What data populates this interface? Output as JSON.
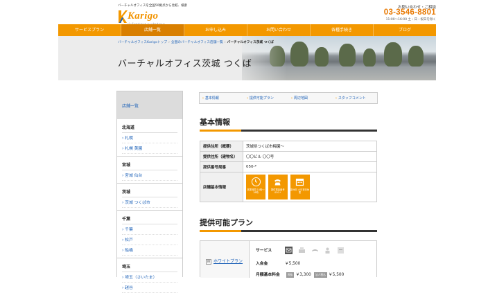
{
  "header": {
    "tagline": "バーチャルオフィスを全国50拠点から比較、検索",
    "logo_text": "Karigo",
    "logo_sub": "バーチャルオフィス・レンタルオフィス",
    "contact_label": "お問い合わせ・ご相談",
    "phone": "03-3546-8801",
    "hours": "11:00〜16:00 土・日・祝日を除く"
  },
  "nav": {
    "items": [
      "サービスプラン",
      "店舗一覧",
      "お申し込み",
      "お問い合わせ",
      "各種手続き",
      "ブログ"
    ],
    "active_index": 1
  },
  "hero": {
    "breadcrumb": [
      "バーチャルオフィスKarigoトップ",
      "全国のバーチャルオフィス店舗一覧"
    ],
    "breadcrumb_current": "バーチャルオフィス茨城 つくば",
    "title": "バーチャルオフィス茨城 つくば"
  },
  "sidebar": {
    "head": "店舗一覧",
    "regions": [
      {
        "name": "北海道",
        "links": [
          "札幌",
          "札幌 美園"
        ]
      },
      {
        "name": "宮城",
        "links": [
          "宮城 仙台"
        ]
      },
      {
        "name": "茨城",
        "links": [
          "茨城 つくば市"
        ]
      },
      {
        "name": "千葉",
        "links": [
          "千葉",
          "松戸",
          "船橋"
        ]
      },
      {
        "name": "埼玉",
        "links": [
          "埼玉（さいたま）",
          "越谷"
        ]
      }
    ]
  },
  "tabs": [
    "基本情報",
    "提供可能プラン",
    "周辺地図",
    "スタッフコメント"
  ],
  "basic": {
    "title": "基本情報",
    "rows": [
      {
        "label": "提供住所（概要）",
        "value": "茨城県つくば市梅園〜"
      },
      {
        "label": "提供住所（建物名）",
        "value": "〇〇ビル 〇〇号"
      },
      {
        "label": "提供番号局番",
        "value": "050-*"
      }
    ],
    "store_label": "店舗基本情報",
    "badges": [
      {
        "icon": "clock-icon",
        "text": "営業時間 10時〜18時"
      },
      {
        "icon": "phone-icon",
        "text": "提供電話番号 050-*"
      },
      {
        "icon": "calendar-icon",
        "text": "定休日 土日祝日休業"
      }
    ]
  },
  "plans": {
    "title": "提供可能プラン",
    "plan_name": "ホワイトプラン",
    "plan_mark": "W",
    "service_label": "サービス",
    "services": [
      "mail-icon",
      "fax-icon",
      "phone-transfer-icon",
      "meeting-icon",
      "staff-icon"
    ],
    "entry_label": "入会金",
    "entry_value": "￥5,500",
    "monthly_label": "月額基本料金",
    "monthly_tag1": "税抜",
    "monthly_value1": "￥3,300",
    "monthly_tag2": "法人税込",
    "monthly_value2": "￥5,500"
  },
  "colors": {
    "accent": "#f39800",
    "link": "#1e62b8",
    "phone": "#e87800"
  }
}
